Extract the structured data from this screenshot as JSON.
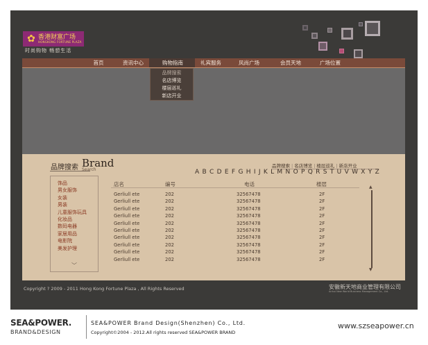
{
  "header": {
    "logo_title": "香港财富广场",
    "logo_sub_en": "HONGKONG FORTUNE PLAZA",
    "slogan": "时尚购物  畅想生活"
  },
  "nav": {
    "items": [
      "首页",
      "资讯中心",
      "购物指南",
      "礼宾服务",
      "风尚广场",
      "会员天地",
      "广场位置"
    ],
    "active_index": 2,
    "dropdown": [
      "品牌搜索",
      "名店博览",
      "楼层巡礼",
      "新店开业"
    ]
  },
  "brand_section": {
    "title_cn": "品牌搜索",
    "title_en": "Brand",
    "title_sub": "Search",
    "quick_links": [
      "品牌搜索",
      "名店博览",
      "楼层巡礼",
      "新店开业"
    ],
    "alphabet": [
      "A",
      "B",
      "C",
      "D",
      "E",
      "F",
      "G",
      "H",
      "I",
      "J",
      "K",
      "L",
      "M",
      "N",
      "O",
      "P",
      "Q",
      "R",
      "S",
      "T",
      "U",
      "V",
      "W",
      "X",
      "Y",
      "Z"
    ],
    "categories": [
      "饰品",
      "男女服饰",
      "女装",
      "男装",
      "儿童服饰玩具",
      "化妆品",
      "数码电器",
      "家居用品",
      "电影院",
      "美发护理"
    ],
    "table": {
      "headers": [
        "店名",
        "编号",
        "电话",
        "楼层"
      ],
      "rows": [
        [
          "Gerliull ete",
          "202",
          "32567478",
          "2F"
        ],
        [
          "Gerliull ete",
          "202",
          "32567478",
          "2F"
        ],
        [
          "Gerliull ete",
          "202",
          "32567478",
          "2F"
        ],
        [
          "Gerliull ete",
          "202",
          "32567478",
          "2F"
        ],
        [
          "Gerliull ete",
          "202",
          "32567478",
          "2F"
        ],
        [
          "Gerliull ete",
          "202",
          "32567478",
          "2F"
        ],
        [
          "Gerliull ete",
          "202",
          "32567478",
          "2F"
        ],
        [
          "Gerliull ete",
          "202",
          "32567478",
          "2F"
        ],
        [
          "Gerliull ete",
          "202",
          "32567478",
          "2F"
        ],
        [
          "Gerliull ete",
          "202",
          "32567478",
          "2F"
        ]
      ]
    }
  },
  "footer": {
    "copyright": "Copyright ? 2009 - 2011 Hong Kong Fortune Plaza , All Rights Reserved",
    "company_cn": "安徽新天地商业管理有限公司",
    "company_en": "Anhui New World Business Management Co., Ltd."
  },
  "watermark": {
    "logo": "SEA&POWER.",
    "logo_sub": "BRAND&DESIGN",
    "company": "SEA&POWER Brand Design(Shenzhen) Co., Ltd.",
    "rights": "Copyright©2004 - 2012.All rights reserved SEA&POWER BRAND",
    "url": "www.szseapower.cn"
  },
  "colors": {
    "frame_bg": "#3b3a38",
    "nav_bg": "#7a4a3a",
    "content_bg": "#d9c4a8",
    "banner_bg": "#6a6969",
    "logo_bg": "#8d2a74"
  }
}
